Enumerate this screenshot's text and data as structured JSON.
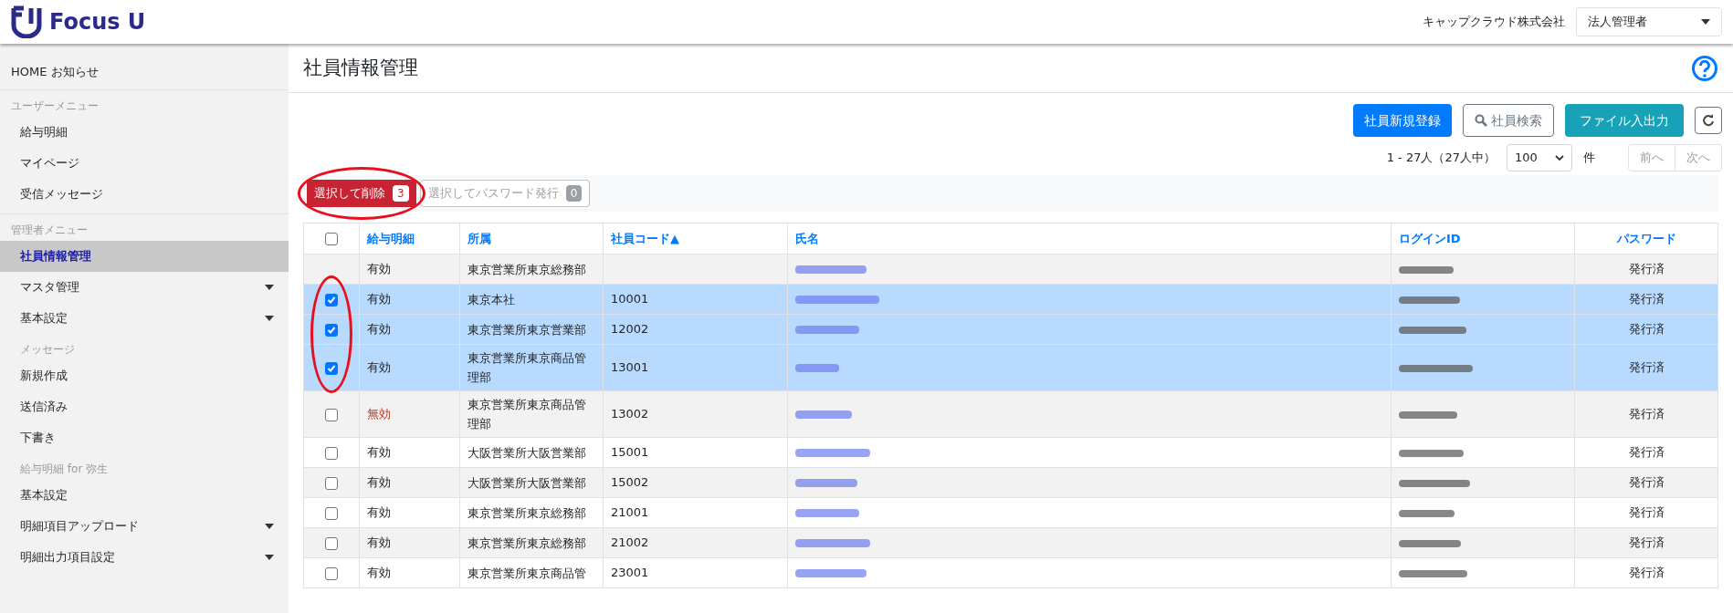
{
  "header": {
    "brand": "Focus U",
    "company": "キャップクラウド株式会社",
    "role_select": "法人管理者"
  },
  "sidebar": {
    "home": "HOME お知らせ",
    "sections": [
      {
        "heading": "ユーザーメニュー",
        "items": [
          {
            "label": "給与明細",
            "selected": false,
            "submenu": false
          },
          {
            "label": "マイページ",
            "selected": false,
            "submenu": false
          },
          {
            "label": "受信メッセージ",
            "selected": false,
            "submenu": false
          }
        ]
      },
      {
        "heading": "管理者メニュー",
        "items": [
          {
            "label": "社員情報管理",
            "selected": true,
            "submenu": false
          },
          {
            "label": "マスタ管理",
            "selected": false,
            "submenu": true
          },
          {
            "label": "基本設定",
            "selected": false,
            "submenu": true
          }
        ]
      },
      {
        "heading": "メッセージ",
        "items": [
          {
            "label": "新規作成",
            "selected": false,
            "submenu": false
          },
          {
            "label": "送信済み",
            "selected": false,
            "submenu": false
          },
          {
            "label": "下書き",
            "selected": false,
            "submenu": false
          }
        ]
      },
      {
        "heading": "給与明細 for 弥生",
        "items": [
          {
            "label": "基本設定",
            "selected": false,
            "submenu": false
          },
          {
            "label": "明細項目アップロード",
            "selected": false,
            "submenu": true
          },
          {
            "label": "明細出力項目設定",
            "selected": false,
            "submenu": true
          }
        ]
      }
    ]
  },
  "page": {
    "title": "社員情報管理",
    "actions": [
      {
        "kind": "primary",
        "label": "社員新規登録"
      },
      {
        "kind": "search",
        "label": "社員検索"
      },
      {
        "kind": "info",
        "label": "ファイル入出力"
      },
      {
        "kind": "refresh"
      }
    ],
    "pagination": {
      "summary": "1 - 27人（27人中）",
      "page_size": "100",
      "unit": "件",
      "prev": "前へ",
      "next": "次へ"
    },
    "bulk_actions": [
      {
        "label": "選択して削除",
        "count": "3",
        "disabled": false
      },
      {
        "label": "選択してパスワード発行",
        "count": "0",
        "disabled": true
      }
    ],
    "table": {
      "columns": [
        "給与明細",
        "所属",
        "社員コード▲",
        "氏名",
        "ログインID",
        "パスワード"
      ],
      "select_all_checked": false,
      "rows": [
        {
          "kind": "locked",
          "status": "有効",
          "color": "#212529",
          "department": "東京営業所東京総務部",
          "code": "",
          "password": "発行済"
        },
        {
          "kind": "selectable",
          "checked": true,
          "status": "有効",
          "color": "#212529",
          "department": "東京本社",
          "code": "10001",
          "password": "発行済"
        },
        {
          "kind": "selectable",
          "checked": true,
          "status": "有効",
          "color": "#212529",
          "department": "東京営業所東京営業部",
          "code": "12002",
          "password": "発行済"
        },
        {
          "kind": "selectable",
          "checked": true,
          "status": "有効",
          "color": "#212529",
          "department": "東京営業所東京商品管理部",
          "code": "13001",
          "password": "発行済"
        },
        {
          "kind": "selectable",
          "checked": false,
          "status": "無効",
          "color": "#c0392b",
          "department": "東京営業所東京商品管理部",
          "code": "13002",
          "password": "発行済"
        },
        {
          "kind": "selectable",
          "checked": false,
          "status": "有効",
          "color": "#212529",
          "department": "大阪営業所大阪営業部",
          "code": "15001",
          "password": "発行済"
        },
        {
          "kind": "selectable",
          "checked": false,
          "status": "有効",
          "color": "#212529",
          "department": "大阪営業所大阪営業部",
          "code": "15002",
          "password": "発行済"
        },
        {
          "kind": "selectable",
          "checked": false,
          "status": "有効",
          "color": "#212529",
          "department": "東京営業所東京総務部",
          "code": "21001",
          "password": "発行済"
        },
        {
          "kind": "selectable",
          "checked": false,
          "status": "有効",
          "color": "#212529",
          "department": "東京営業所東京総務部",
          "code": "21002",
          "password": "発行済"
        },
        {
          "kind": "selectable",
          "checked": false,
          "status": "有効",
          "color": "#212529",
          "department": "東京営業所東京商品管",
          "code": "23001",
          "password": "発行済"
        }
      ]
    }
  }
}
